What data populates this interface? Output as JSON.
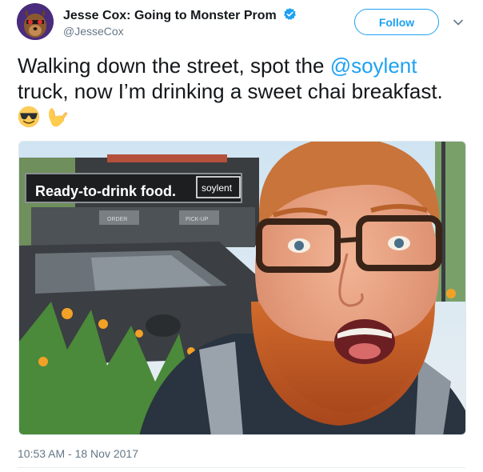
{
  "author": {
    "name": "Jesse Cox: Going to Monster Prom",
    "handle": "@JesseCox",
    "verified": true
  },
  "follow_label": "Follow",
  "tweet": {
    "text_parts": [
      "Walking down the street, spot the ",
      "@soylent",
      " truck, now I’m drinking a sweet chai breakfast. "
    ],
    "emojis": [
      "smiling-face-with-sunglasses",
      "call-me-hand"
    ]
  },
  "photo": {
    "sign_text": "Ready-to-drink food.",
    "brand_text": "soylent",
    "window_left": "ORDER",
    "window_right": "PICK-UP"
  },
  "timestamp": "10:53 AM - 18 Nov 2017",
  "colors": {
    "accent": "#1da1f2",
    "text": "#14171a",
    "secondary": "#657786"
  }
}
